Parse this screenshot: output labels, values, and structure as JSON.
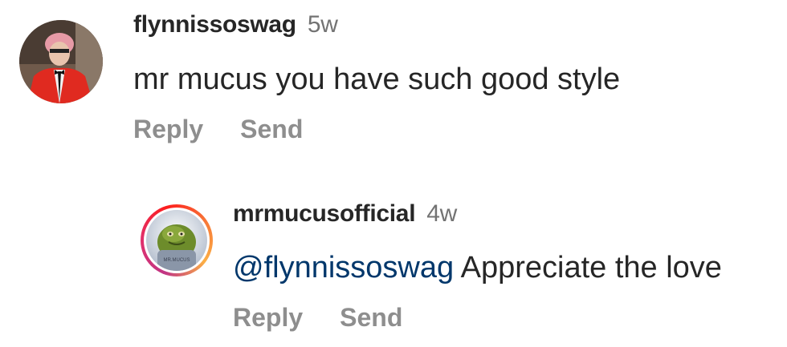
{
  "comments": [
    {
      "username": "flynnissoswag",
      "age": "5w",
      "text": "mr mucus you have such good style",
      "reply_label": "Reply",
      "send_label": "Send"
    },
    {
      "username": "mrmucusofficial",
      "age": "4w",
      "mention": "@flynnissoswag",
      "text": "Appreciate the love",
      "reply_label": "Reply",
      "send_label": "Send",
      "avatar_badge_text": "MR.MUCUS"
    }
  ],
  "colors": {
    "username": "#262626",
    "meta": "#737373",
    "action": "#8e8e8e",
    "mention": "#00376b"
  }
}
